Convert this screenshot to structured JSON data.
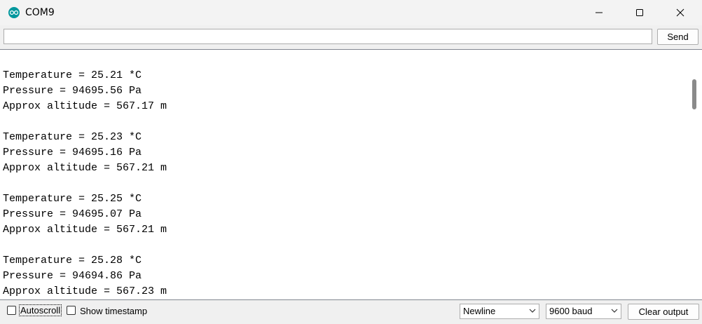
{
  "window": {
    "title": "COM9",
    "icon": "arduino-icon"
  },
  "send_row": {
    "input_value": "",
    "send_label": "Send"
  },
  "output": {
    "lines": [
      "",
      "Temperature = 25.21 *C",
      "Pressure = 94695.56 Pa",
      "Approx altitude = 567.17 m",
      "",
      "Temperature = 25.23 *C",
      "Pressure = 94695.16 Pa",
      "Approx altitude = 567.21 m",
      "",
      "Temperature = 25.25 *C",
      "Pressure = 94695.07 Pa",
      "Approx altitude = 567.21 m",
      "",
      "Temperature = 25.28 *C",
      "Pressure = 94694.86 Pa",
      "Approx altitude = 567.23 m"
    ]
  },
  "bottom": {
    "autoscroll_label": "Autoscroll",
    "autoscroll_checked": false,
    "timestamp_label": "Show timestamp",
    "timestamp_checked": false,
    "line_ending": "Newline",
    "baud_rate": "9600 baud",
    "clear_label": "Clear output"
  },
  "colors": {
    "accent": "#00979d"
  }
}
